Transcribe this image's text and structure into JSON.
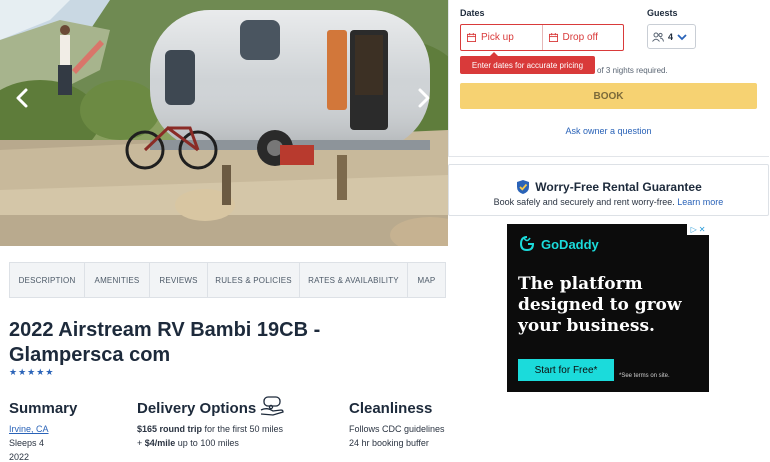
{
  "hero": {
    "prev_icon": "chevron-left-icon",
    "next_icon": "chevron-right-icon"
  },
  "tabs": [
    {
      "label": "DESCRIPTION"
    },
    {
      "label": "AMENITIES"
    },
    {
      "label": "REVIEWS"
    },
    {
      "label": "RULES & POLICIES"
    },
    {
      "label": "RATES & AVAILABILITY"
    },
    {
      "label": "MAP"
    }
  ],
  "listing": {
    "title": "2022 Airstream RV Bambi 19CB - Glampersca com",
    "rating_stars": 5
  },
  "summary": {
    "heading": "Summary",
    "location": "Irvine, CA",
    "sleeps": "Sleeps 4",
    "year": "2022"
  },
  "delivery": {
    "heading": "Delivery Options",
    "line1_bold": "$165 round trip",
    "line1_rest": " for the first 50 miles",
    "line2_prefix": "+ ",
    "line2_bold": "$4/mile",
    "line2_rest": " up to 100 miles"
  },
  "cleanliness": {
    "heading": "Cleanliness",
    "line1": "Follows CDC guidelines",
    "line2": "24 hr booking buffer"
  },
  "booking": {
    "dates_label": "Dates",
    "pickup": "Pick up",
    "dropoff": "Drop off",
    "guests_label": "Guests",
    "guests_value": "4",
    "tooltip": "Enter dates for accurate pricing",
    "min_nights": "of 3 nights required.",
    "book": "BOOK",
    "ask_owner": "Ask owner a question"
  },
  "guarantee": {
    "title": "Worry-Free Rental Guarantee",
    "text": "Book safely and securely and rent worry-free.",
    "learn_more": "Learn more"
  },
  "ad": {
    "brand": "GoDaddy",
    "headline": "The platform designed to grow your business.",
    "cta": "Start for Free*",
    "terms": "*See terms on site.",
    "colors": {
      "accent": "#1bdbdb",
      "background": "#0c0c0c"
    }
  },
  "colors": {
    "error": "#d93a3a",
    "link": "#2a63b8",
    "book_button": "#f6d272"
  }
}
